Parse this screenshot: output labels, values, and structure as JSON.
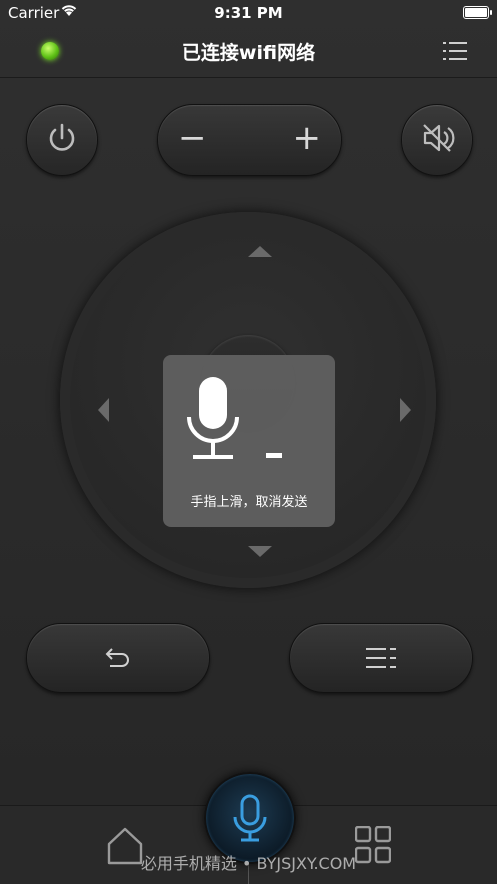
{
  "status_bar": {
    "carrier": "Carrier",
    "time": "9:31 PM"
  },
  "nav": {
    "title": "已连接wifi网络",
    "led_color": "#66cc22",
    "menu_icon": "list-icon"
  },
  "controls": {
    "power_icon": "power-icon",
    "volume_minus": "−",
    "volume_plus": "+",
    "mute_icon": "mute-icon",
    "back_icon": "back-icon",
    "menu_icon": "menu-icon"
  },
  "dpad": {
    "up": "arrow-up",
    "down": "arrow-down",
    "left": "arrow-left",
    "right": "arrow-right"
  },
  "voice_overlay": {
    "hint": "手指上滑，取消发送",
    "mic_icon": "microphone-icon"
  },
  "bottom_bar": {
    "home_icon": "home-icon",
    "apps_icon": "grid-icon",
    "voice_icon": "microphone-icon",
    "accent": "#3a9ee0"
  },
  "watermark": "必用手机精选 • BYJSJXY.COM"
}
